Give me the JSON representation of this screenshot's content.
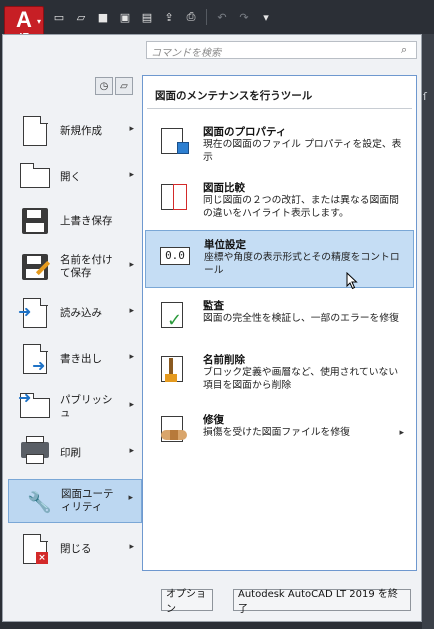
{
  "app_button": {
    "logo": "A",
    "edition": "LT"
  },
  "quick_access_icons": [
    "new-icon",
    "open-icon",
    "save-icon",
    "save-as-icon",
    "open-sheetset-icon",
    "publish-icon",
    "print-icon",
    "undo-icon",
    "redo-icon",
    "customize-icon"
  ],
  "search": {
    "placeholder": "コマンドを検索"
  },
  "left_menu": {
    "items": [
      {
        "id": "new",
        "label": "新規作成",
        "arrow": true
      },
      {
        "id": "open",
        "label": "開く",
        "arrow": true
      },
      {
        "id": "save",
        "label": "上書き保存",
        "arrow": false
      },
      {
        "id": "saveas",
        "label": "名前を付けて保存",
        "arrow": true
      },
      {
        "id": "import",
        "label": "読み込み",
        "arrow": true
      },
      {
        "id": "export",
        "label": "書き出し",
        "arrow": true
      },
      {
        "id": "publish",
        "label": "パブリッシュ",
        "arrow": true
      },
      {
        "id": "print",
        "label": "印刷",
        "arrow": true
      },
      {
        "id": "utilities",
        "label": "図面ユーティリティ",
        "arrow": true,
        "active": true
      },
      {
        "id": "close",
        "label": "閉じる",
        "arrow": true
      }
    ]
  },
  "submenu": {
    "title": "図面のメンテナンスを行うツール",
    "items": [
      {
        "id": "properties",
        "title": "図面のプロパティ",
        "desc": "現在の図面のファイル プロパティを設定、表示"
      },
      {
        "id": "compare",
        "title": "図面比較",
        "desc": "同じ図面の２つの改訂、または異なる図面間の違いをハイライト表示します。"
      },
      {
        "id": "units",
        "title": "単位設定",
        "desc": "座標や角度の表示形式とその精度をコントロール",
        "active": true,
        "icon_text": "0.0"
      },
      {
        "id": "audit",
        "title": "監査",
        "desc": "図面の完全性を検証し、一部のエラーを修復"
      },
      {
        "id": "purge",
        "title": "名前削除",
        "desc": "ブロック定義や画層など、使用されていない項目を図面から削除"
      },
      {
        "id": "recover",
        "title": "修復",
        "desc": "損傷を受けた図面ファイルを修復",
        "arrow": true
      }
    ]
  },
  "buttons": {
    "options": "オプション",
    "exit": "Autodesk AutoCAD LT 2019 を終了"
  },
  "colors": {
    "accent": "#c71f25",
    "highlight": "#bcd7f1",
    "highlight_border": "#7aa7d6"
  }
}
